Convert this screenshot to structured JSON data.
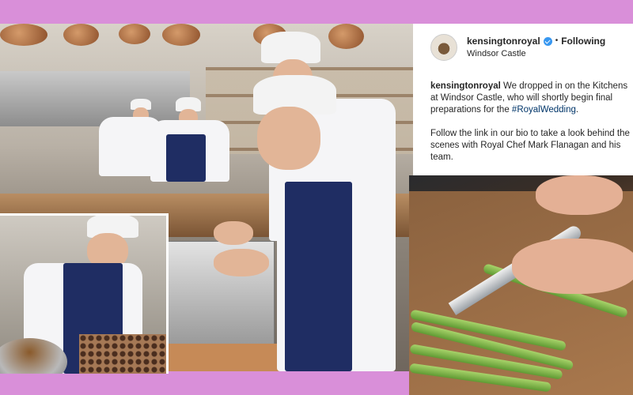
{
  "post": {
    "username": "kensingtonroyal",
    "follow_state": "Following",
    "separator": "•",
    "location": "Windsor Castle",
    "caption_line1_prefix": "We dropped in on the Kitchens at Windsor Castle, who will shortly begin final preparations for the ",
    "hashtag": "#RoyalWedding",
    "caption_line1_suffix": ".",
    "caption_line2": "Follow the link in our bio to take a look behind the scenes with Royal Chef Mark Flanagan and his team."
  },
  "icons": {
    "verified": "verified-badge-icon",
    "avatar": "royal-crest-avatar"
  },
  "colors": {
    "background_band": "#d98fd9",
    "verified_blue": "#3897f0",
    "hashtag_blue": "#003569",
    "text": "#262626"
  }
}
